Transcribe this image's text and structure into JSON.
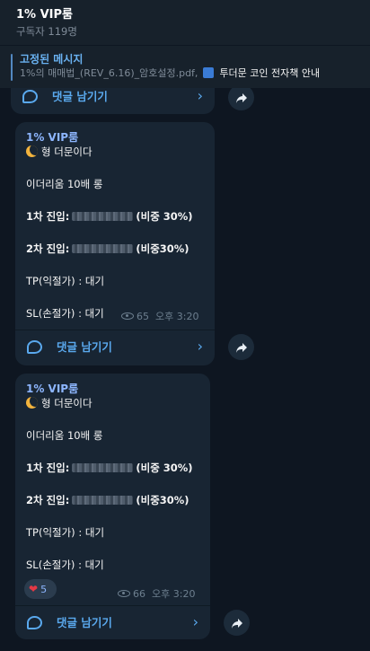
{
  "channel": {
    "title": "1% VIP룸",
    "subtitle": "구독자 119명"
  },
  "pinned": {
    "title": "고정된 메시지",
    "text_gray": "1%의 매매법_(REV_6.16)_암호설정.pdf,",
    "text_white": "투더문 코인 전자책 안내"
  },
  "comments_label": "댓글 남기기",
  "chevron": "›",
  "posts": [
    {
      "author": "1% VIP룸",
      "greeting": "형 더문이다",
      "coin": "이더리움 10배 롱",
      "entry1_label": "1차 진입:",
      "entry1_weight": "(비중 30%)",
      "entry2_label": "2차 진입:",
      "entry2_weight": "(비중30%)",
      "tp": "TP(익절가) : 대기",
      "sl": "SL(손절가) : 대기",
      "views": "65",
      "time": "오후 3:20"
    },
    {
      "author": "1% VIP룸",
      "greeting": "형 더문이다",
      "coin": "이더리움 10배 롱",
      "entry1_label": "1차 진입:",
      "entry1_weight": "(비중 30%)",
      "entry2_label": "2차 진입:",
      "entry2_weight": "(비중30%)",
      "tp": "TP(익절가) : 대기",
      "sl": "SL(손절가) : 대기",
      "reactions": "5",
      "views": "66",
      "time": "오후 3:20"
    }
  ],
  "colors": {
    "bg": "#0e1621",
    "bubble": "#182533",
    "accent": "#5aa9ee",
    "author": "#8db6ff"
  }
}
